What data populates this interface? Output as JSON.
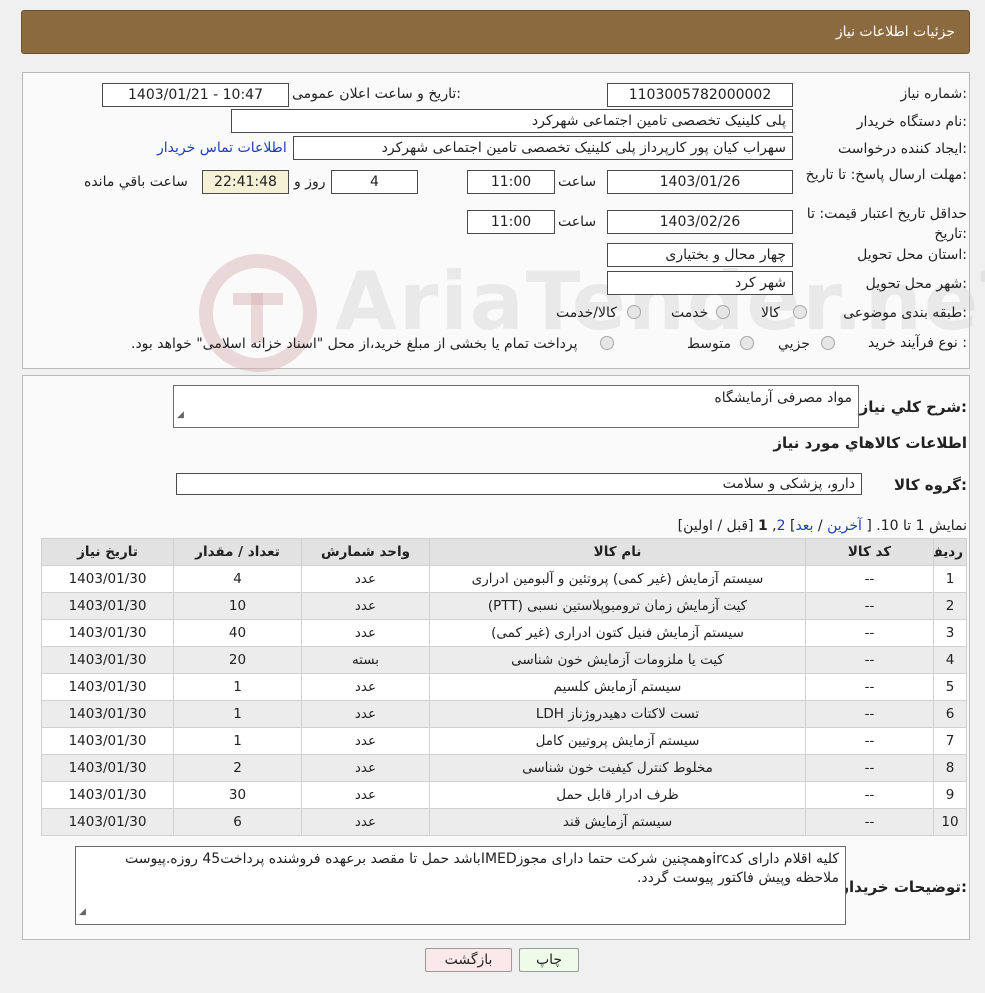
{
  "header": {
    "title": "جزئیات اطلاعات نیاز"
  },
  "form": {
    "need_number_label": "شماره نیاز:",
    "need_number": "1103005782000002",
    "announce_label": "تاریخ و ساعت اعلان عمومی:",
    "announce_value": "1403/01/21 - 10:47",
    "buyer_label": "نام دستگاه خریدار:",
    "buyer_value": "پلی کلینیک تخصصی تامین اجتماعی شهرکرد",
    "creator_label": "ایجاد کننده درخواست:",
    "creator_value": "سهراب کیان پور کارپرداز پلی کلینیک تخصصی تامین اجتماعی شهرکرد",
    "contact_link": "اطلاعات تماس خریدار",
    "deadline_label": "مهلت ارسال پاسخ: تا تاریخ:",
    "deadline_date": "1403/01/26",
    "time_label": "ساعت",
    "deadline_time": "11:00",
    "days_value": "4",
    "day_and_label": "روز و",
    "remaining_time": "22:41:48",
    "remaining_label": "ساعت باقي مانده",
    "validity_label": "حداقل تاریخ اعتبار قیمت: تا تاریخ:",
    "validity_date": "1403/02/26",
    "validity_time": "11:00",
    "province_label": "استان محل تحویل:",
    "province_value": "چهار محال و بختیاری",
    "city_label": "شهر محل تحویل:",
    "city_value": "شهر کرد",
    "category_label": "طبقه بندی موضوعی:",
    "category_options": [
      "کالا",
      "خدمت",
      "کالا/خدمت"
    ],
    "process_label": "نوع فرآیند خرید :",
    "process_options": [
      "جزیي",
      "متوسط"
    ],
    "process_note": "پرداخت تمام یا بخشی از مبلغ خرید،از محل \"اسناد خزانه اسلامی\" خواهد بود."
  },
  "watermark": {
    "text": "AriaTender.neT"
  },
  "details": {
    "summary_label": "شرح کلي نیاز:",
    "summary_value": "مواد مصرفی آزمایشگاه",
    "goods_info_title": "اطلاعات کالاهاي مورد نیاز",
    "group_label": "گروه کالا:",
    "group_value": "دارو، پزشکی و سلامت",
    "pagination": {
      "showing": "نمایش 1 تا 10.",
      "open": "[",
      "last": "آخرین",
      "sep1": "/",
      "next": "بعد",
      "close": "]",
      "page2": "2",
      "comma": ",",
      "page1": "1",
      "rest": "[قبل / اولین]"
    },
    "table": {
      "headers": [
        "ردیف",
        "کد کالا",
        "نام کالا",
        "واحد شمارش",
        "تعداد / مقدار",
        "تاریخ نیاز"
      ],
      "rows": [
        [
          "1",
          "--",
          "سیستم آزمایش (غیر کمی) پروتئین و آلبومین ادراری",
          "عدد",
          "4",
          "1403/01/30"
        ],
        [
          "2",
          "--",
          "کیت آزمایش زمان ترومبوپلاستین نسبی (PTT)",
          "عدد",
          "10",
          "1403/01/30"
        ],
        [
          "3",
          "--",
          "سیستم آزمایش فنیل کتون ادراری (غیر کمی)",
          "عدد",
          "40",
          "1403/01/30"
        ],
        [
          "4",
          "--",
          "کیت یا ملزومات آزمایش خون شناسی",
          "بسته",
          "20",
          "1403/01/30"
        ],
        [
          "5",
          "--",
          "سیستم آزمایش کلسیم",
          "عدد",
          "1",
          "1403/01/30"
        ],
        [
          "6",
          "--",
          "تست لاکتات دهیدروژناز LDH",
          "عدد",
          "1",
          "1403/01/30"
        ],
        [
          "7",
          "--",
          "سیستم آزمایش پروتیین کامل",
          "عدد",
          "1",
          "1403/01/30"
        ],
        [
          "8",
          "--",
          "مخلوط کنترل کیفیت خون شناسی",
          "عدد",
          "2",
          "1403/01/30"
        ],
        [
          "9",
          "--",
          "ظرف ادرار قابل حمل",
          "عدد",
          "30",
          "1403/01/30"
        ],
        [
          "10",
          "--",
          "سیستم آزمایش قند",
          "عدد",
          "6",
          "1403/01/30"
        ]
      ]
    },
    "buyer_notes_label": "توضیحات خریدار:",
    "buyer_notes_value": "کلیه اقلام دارای کدircوهمچنین شرکت حتما دارای مجوزIMEDباشد حمل تا مقصد برعهده فروشنده پرداخت45 روزه.پیوست ملاحظه وپیش فاکتور پیوست گردد."
  },
  "buttons": {
    "print": "چاپ",
    "back": "بازگشت"
  }
}
